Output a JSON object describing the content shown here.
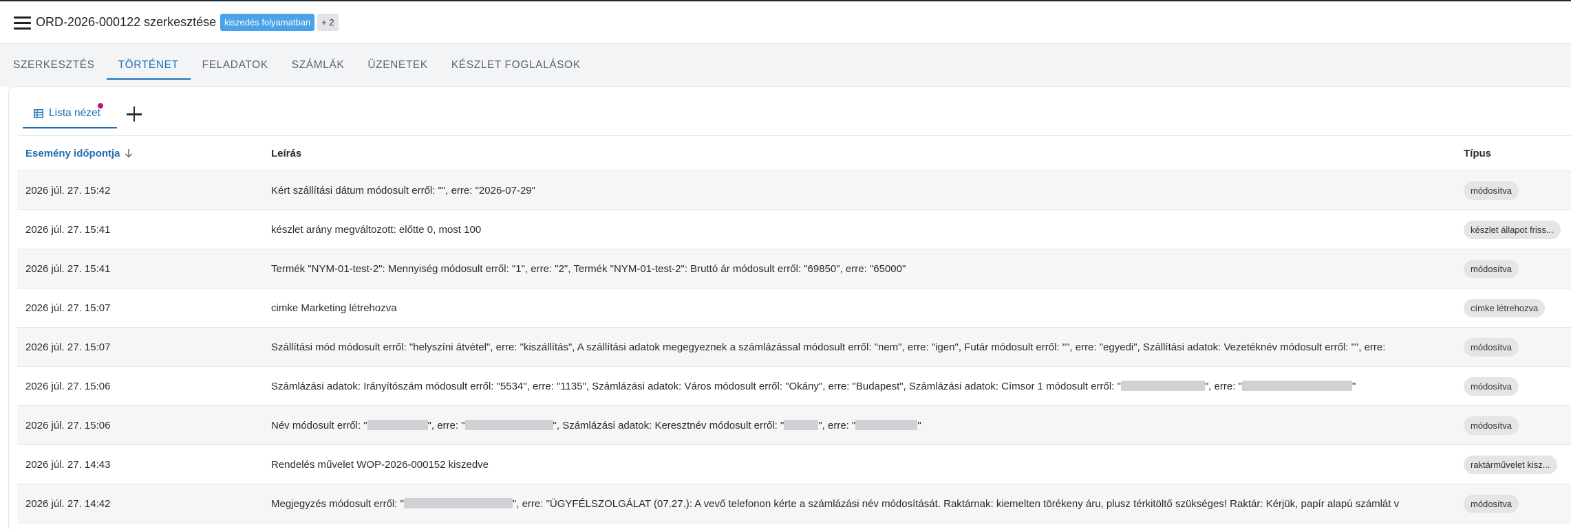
{
  "header": {
    "title": "ORD-2026-000122 szerkesztése",
    "status_badge": "kiszedés folyamatban",
    "more_badge": "+ 2",
    "icons": {
      "menu": "hamburger-menu-icon"
    },
    "colors": {
      "status_badge_bg": "#4aa3e8",
      "accent": "#1f6fb2"
    }
  },
  "tabs": [
    {
      "label": "SZERKESZTÉS",
      "active": false
    },
    {
      "label": "TÖRTÉNET",
      "active": true
    },
    {
      "label": "FELADATOK",
      "active": false
    },
    {
      "label": "SZÁMLÁK",
      "active": false
    },
    {
      "label": "ÜZENETEK",
      "active": false
    },
    {
      "label": "KÉSZLET FOGLALÁSOK",
      "active": false
    }
  ],
  "view": {
    "label": "Lista nézet",
    "icons": {
      "view": "table-grid-icon",
      "add": "plus-icon"
    }
  },
  "table": {
    "columns": {
      "time": "Esemény időpontja",
      "desc": "Leírás",
      "type": "Típus"
    },
    "rows": [
      {
        "time": "2026 júl. 27. 15:42",
        "desc": [
          "Kért szállítási dátum módosult erről: \"\", erre: \"2026-07-29\""
        ],
        "type": "módosítva"
      },
      {
        "time": "2026 júl. 27. 15:41",
        "desc": [
          "készlet arány megváltozott: előtte 0, most 100"
        ],
        "type": "készlet állapot friss..."
      },
      {
        "time": "2026 júl. 27. 15:41",
        "desc": [
          "Termék \"NYM-01-test-2\": Mennyiség módosult erről: \"1\", erre: \"2\", Termék \"NYM-01-test-2\": Bruttó ár módosult erről: \"69850\", erre: \"65000\""
        ],
        "type": "módosítva"
      },
      {
        "time": "2026 júl. 27. 15:07",
        "desc": [
          "cimke Marketing létrehozva"
        ],
        "type": "címke létrehozva"
      },
      {
        "time": "2026 júl. 27. 15:07",
        "desc": [
          "Szállítási mód módosult erről: \"helyszíni átvétel\", erre: \"kiszállítás\", A szállítási adatok megegyeznek a számlázással módosult erről: \"nem\", erre: \"igen\", Futár módosult erről: \"\", erre: \"egyedi\", Szállítási adatok: Vezetéknév módosult erről: \"\", erre:"
        ],
        "type": "módosítva"
      },
      {
        "time": "2026 júl. 27. 15:06",
        "desc": [
          "Számlázási adatok: Irányítószám módosult erről: \"5534\", erre: \"1135\", Számlázási adatok: Város módosult erről: \"Okány\", erre: \"Budapest\", Számlázási adatok: Címsor 1 módosult erről: \"",
          "\", erre: \"",
          "\""
        ],
        "type": "módosítva"
      },
      {
        "time": "2026 júl. 27. 15:06",
        "desc": [
          "Név módosult erről: \"",
          "\", erre: \"",
          "\", Számlázási adatok: Keresztnév módosult erről: \"",
          "\", erre: \"",
          "\""
        ],
        "type": "módosítva"
      },
      {
        "time": "2026 júl. 27. 14:43",
        "desc": [
          "Rendelés művelet WOP-2026-000152 kiszedve"
        ],
        "type": "raktárművelet kisz..."
      },
      {
        "time": "2026 júl. 27. 14:42",
        "desc": [
          "Megjegyzés módosult erről: \"",
          "\", erre: \"ÜGYFÉLSZOLGÁLAT (07.27.): A vevő telefonon kérte a számlázási név módosítását. Raktárnak: kiemelten törékeny áru, plusz térkitöltő szükséges! Raktár: Kérjük, papír alapú számlát v"
        ],
        "type": "módosítva"
      }
    ]
  }
}
